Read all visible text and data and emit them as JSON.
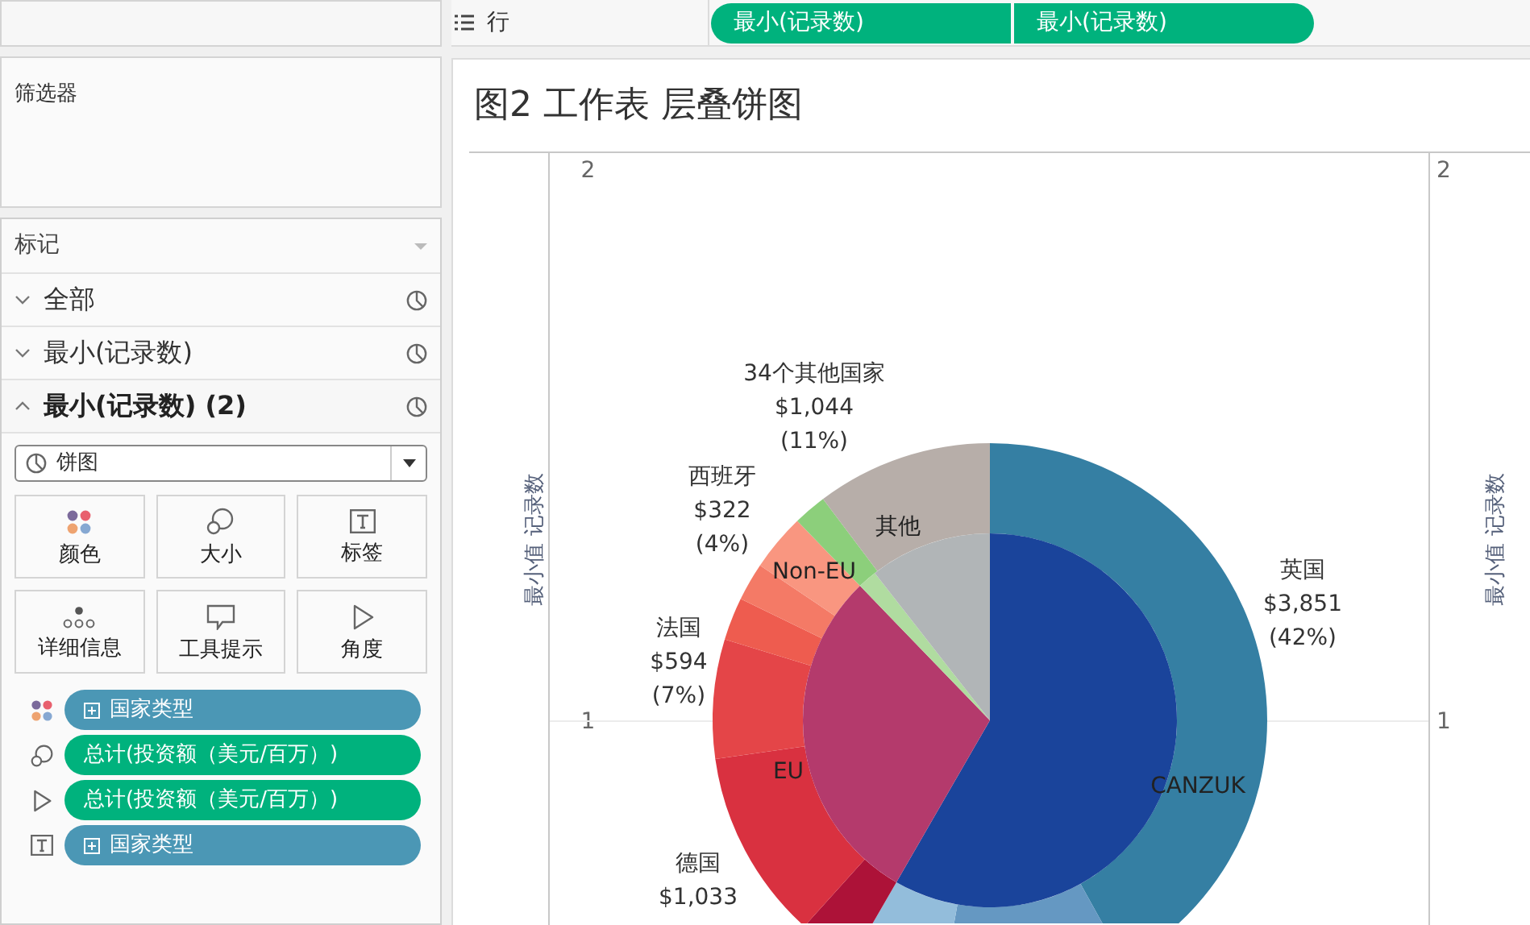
{
  "rows_shelf": {
    "label": "行",
    "pills": [
      "最小(记录数)",
      "最小(记录数)"
    ]
  },
  "filters": {
    "title": "筛选器"
  },
  "marks": {
    "title": "标记",
    "layers": [
      {
        "label": "全部",
        "expanded": false
      },
      {
        "label": "最小(记录数)",
        "expanded": false
      },
      {
        "label": "最小(记录数) (2)",
        "expanded": true
      }
    ],
    "mark_type": "饼图",
    "cards": [
      {
        "kind": "color",
        "label": "颜色"
      },
      {
        "kind": "size",
        "label": "大小"
      },
      {
        "kind": "label",
        "label": "标签"
      },
      {
        "kind": "detail",
        "label": "详细信息"
      },
      {
        "kind": "tooltip",
        "label": "工具提示"
      },
      {
        "kind": "angle",
        "label": "角度"
      }
    ],
    "fields": [
      {
        "kind": "color",
        "dimension": true,
        "label": "国家类型"
      },
      {
        "kind": "size",
        "dimension": false,
        "label": "总计(投资额（美元/百万）)"
      },
      {
        "kind": "angle",
        "dimension": false,
        "label": "总计(投资额（美元/百万）)"
      },
      {
        "kind": "label",
        "dimension": true,
        "label": "国家类型"
      }
    ]
  },
  "sheet": {
    "title": "图2 工作表 层叠饼图",
    "axis_left": {
      "title": "最小值 记录数",
      "ticks": [
        "2",
        "1"
      ]
    },
    "axis_right": {
      "title": "最小值 记录数",
      "ticks": [
        "2",
        "1"
      ]
    },
    "outer_labels": [
      {
        "lines": [
          "34个其他国家",
          "$1,044",
          "(11%)"
        ]
      },
      {
        "lines": [
          "西班牙",
          "$322",
          "(4%)"
        ]
      },
      {
        "lines": [
          "法国",
          "$594",
          "(7%)"
        ]
      },
      {
        "lines": [
          "德国",
          "$1,033"
        ]
      },
      {
        "lines": [
          "英国",
          "$3,851",
          "(42%)"
        ]
      }
    ],
    "inner_labels": [
      "其他",
      "Non-EU",
      "EU",
      "CANZUK"
    ]
  }
}
